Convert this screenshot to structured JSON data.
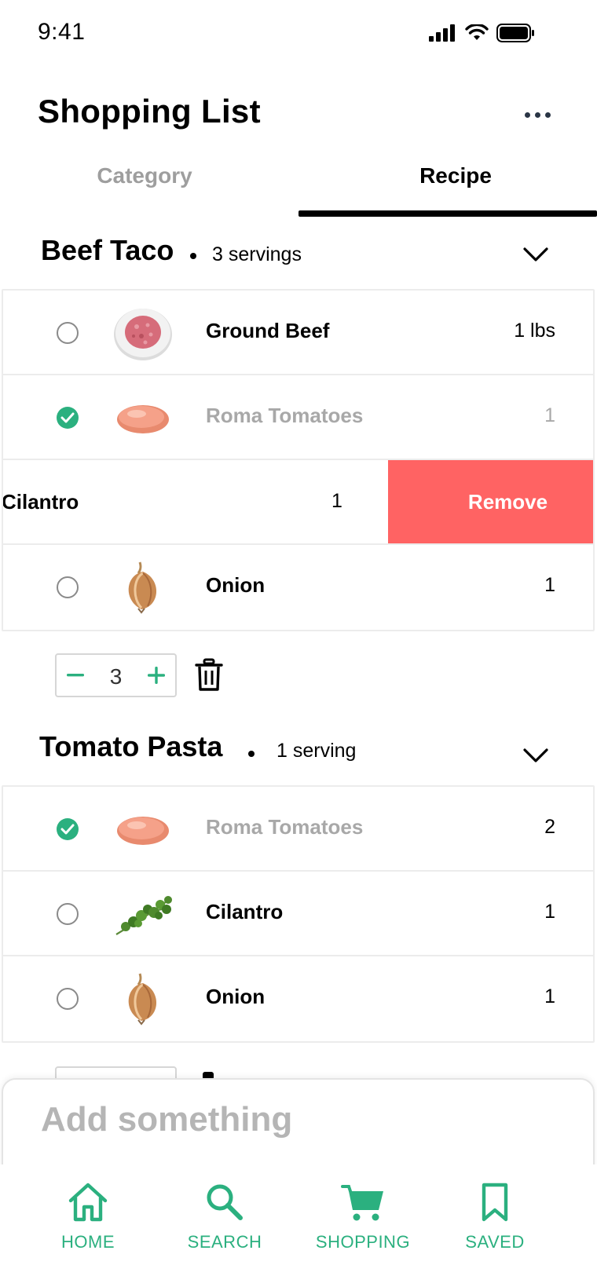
{
  "status_bar": {
    "time": "9:41"
  },
  "header": {
    "title": "Shopping List"
  },
  "tabs": [
    {
      "label": "Category",
      "active": false
    },
    {
      "label": "Recipe",
      "active": true
    }
  ],
  "recipes": [
    {
      "name": "Beef Taco",
      "servings_label": "3 servings",
      "items": [
        {
          "name": "Ground Beef",
          "qty": "1 lbs",
          "checked": false,
          "icon": "ground-beef"
        },
        {
          "name": "Roma Tomatoes",
          "qty": "1",
          "checked": true,
          "icon": "tomato"
        }
      ],
      "swiped_item": {
        "name": "Cilantro",
        "qty": "1",
        "action_label": "Remove"
      },
      "items_after": [
        {
          "name": "Onion",
          "qty": "1",
          "checked": false,
          "icon": "onion"
        }
      ],
      "stepper_value": "3"
    },
    {
      "name": "Tomato Pasta",
      "servings_label": "1 serving",
      "items": [
        {
          "name": "Roma Tomatoes",
          "qty": "2",
          "checked": true,
          "icon": "tomato"
        },
        {
          "name": "Cilantro",
          "qty": "1",
          "checked": false,
          "icon": "cilantro"
        },
        {
          "name": "Onion",
          "qty": "1",
          "checked": false,
          "icon": "onion"
        }
      ]
    }
  ],
  "add_bar": {
    "placeholder": "Add something"
  },
  "tab_bar": [
    {
      "label": "HOME",
      "icon": "home-icon"
    },
    {
      "label": "SEARCH",
      "icon": "search-icon"
    },
    {
      "label": "SHOPPING",
      "icon": "cart-icon",
      "active": true
    },
    {
      "label": "SAVED",
      "icon": "bookmark-icon"
    }
  ],
  "colors": {
    "accent": "#2bb07f",
    "remove": "#ff6363",
    "muted_text": "#a8a8a8"
  }
}
